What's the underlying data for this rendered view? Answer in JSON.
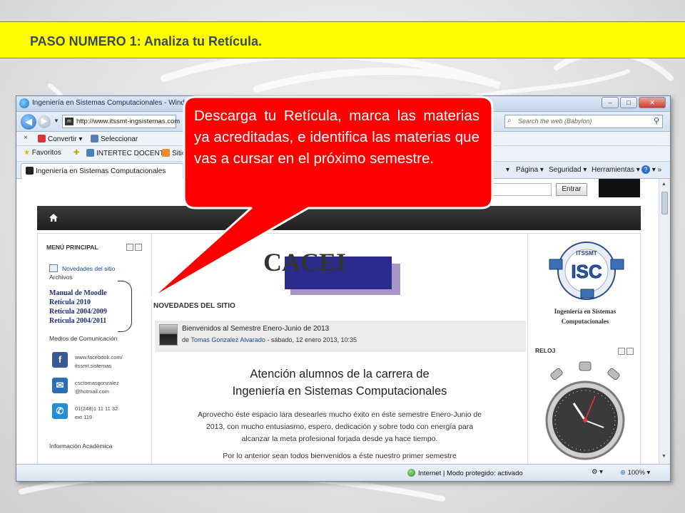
{
  "slide": {
    "title": "PASO NUMERO 1: Analiza tu Retícula."
  },
  "browser": {
    "window_title": "Ingeniería en Sistemas Computacionales - Windows I",
    "address": "http://www.itssmt-ingsistemas.com",
    "search_placeholder": "Search the web (Babylon)",
    "commands": {
      "close": "×",
      "convert": "Convertir",
      "select": "Seleccionar"
    },
    "favorites": {
      "label": "Favoritos",
      "links": [
        "INTERTEC DOCENTE",
        "Sitio"
      ]
    },
    "tab": {
      "label": "Ingeniería en Sistemas Computacionales"
    },
    "page_menu": [
      "Página",
      "Seguridad",
      "Herramientas"
    ],
    "status": {
      "zone": "Internet | Modo protegido: activado",
      "zoom": "100%"
    }
  },
  "site": {
    "login_button": "Entrar",
    "left": {
      "main_menu_title": "MENÚ PRINCIPAL",
      "news_link": "Novedades del sitio",
      "files_label": "Archivos",
      "documents": [
        "Manual de Moodle",
        "Retícula 2010",
        "Retícula 2004/2009",
        "Retícula 2004/2011"
      ],
      "media_title": "Medios de Comunicación",
      "contacts": [
        {
          "icon": "facebook-icon",
          "color": "#3b5998",
          "glyph": "f",
          "lines": [
            "www.facebook.com/",
            "itssmt.sistemas"
          ]
        },
        {
          "icon": "mail-icon",
          "color": "#2a6fb8",
          "glyph": "✉",
          "lines": [
            "csctomasgonzalez",
            "@hotmail.com"
          ]
        },
        {
          "icon": "phone-icon",
          "color": "#1f8fd6",
          "glyph": "✆",
          "lines": [
            "01(248)1 11 11 32",
            "ext 119"
          ]
        }
      ],
      "academic_info": "Información Académica"
    },
    "center": {
      "logo_text": "CACEI",
      "section_title": "NOVEDADES DEL SITIO",
      "post": {
        "title": "Bienvenidos al Semestre Enero-Junio de 2013",
        "prefix": "de",
        "author": "Tomas Gonzalez Alvarado",
        "date": "- sábado, 12 enero 2013, 10:35"
      },
      "heading": [
        "Atención alumnos de la carrera de",
        "Ingeniería en Sistemas Computacionales"
      ],
      "body": [
        "Aprovecho éste espacio lara desearles mucho éxito en éste semestre Enero-Junio de",
        "2013, con mucho entusiasmo, espero, dedicación y sobre todo con energía para",
        "alcanzar la meta profesional forjada desde ya hace tiempo.",
        "Por lo anterior sean todos bienvenidos a éste nuestro primer semestre"
      ]
    },
    "right": {
      "logo_text": "ISC",
      "logo_top": "ITSSMT",
      "caption": [
        "Ingeniería en Sistemas",
        "Computacionales"
      ],
      "clock_title": "RELOJ"
    }
  },
  "callout": {
    "text": "Descarga tu Retícula, marca las materias ya acreditadas, e identifica las materias que vas a cursar en el próximo semestre."
  },
  "colors": {
    "header_yellow": "#ffff00",
    "callout_red": "#ff0000",
    "navbar": "#222222"
  }
}
